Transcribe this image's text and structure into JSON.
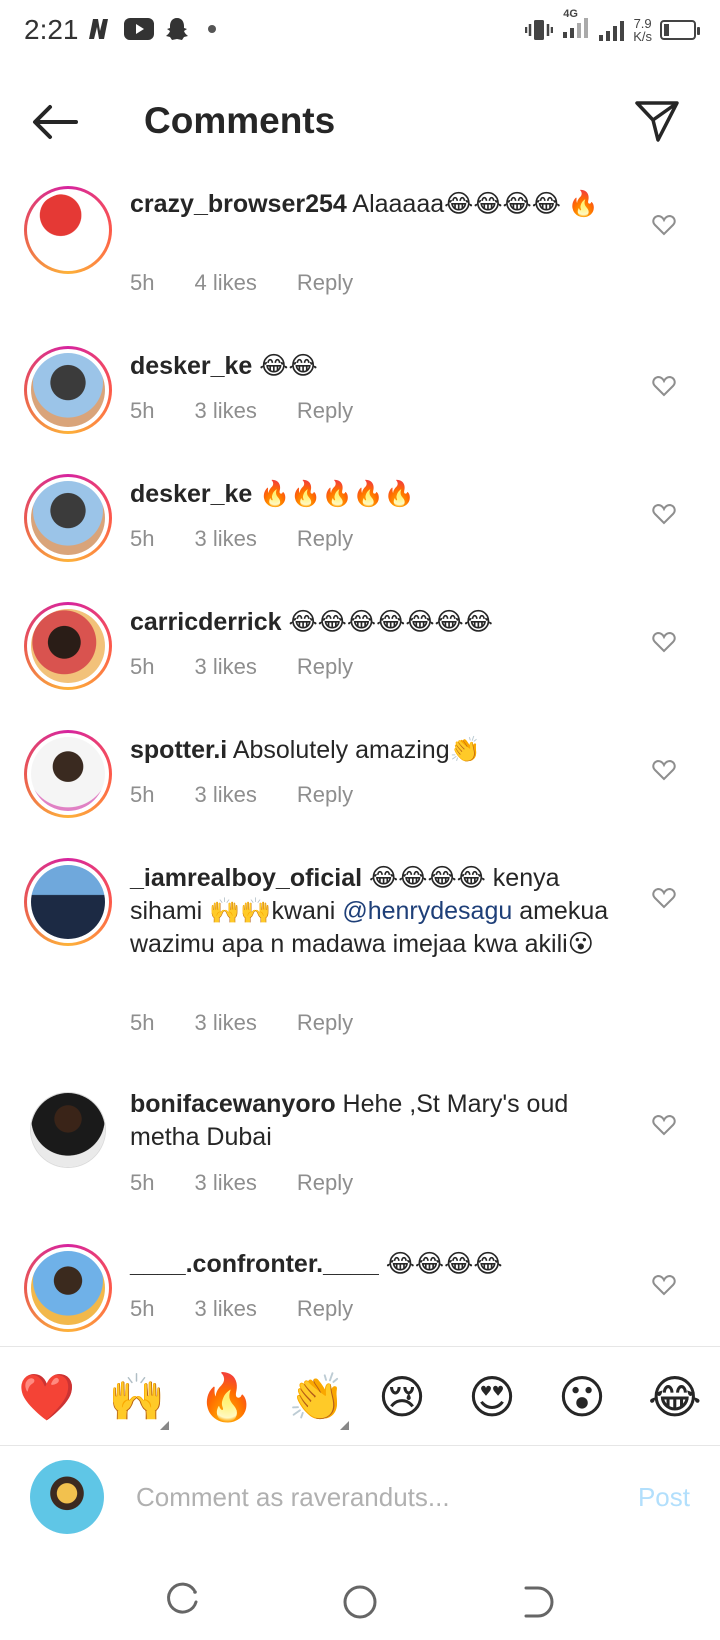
{
  "status_bar": {
    "time": "2:21",
    "network_type": "4G",
    "speed_value": "7.9",
    "speed_unit": "K/s"
  },
  "header": {
    "title": "Comments"
  },
  "comments": [
    {
      "username": "crazy_browser254",
      "text": "Alaaaaa😂😂😂😂 🔥",
      "time": "5h",
      "likes": "4 likes",
      "reply": "Reply"
    },
    {
      "username": "desker_ke",
      "text": "😂😂",
      "time": "5h",
      "likes": "3 likes",
      "reply": "Reply"
    },
    {
      "username": "desker_ke",
      "text": "🔥🔥🔥🔥🔥",
      "time": "5h",
      "likes": "3 likes",
      "reply": "Reply"
    },
    {
      "username": "carricderrick",
      "text": "😂😂😂😂😂😂😂",
      "time": "5h",
      "likes": "3 likes",
      "reply": "Reply"
    },
    {
      "username": "spotter.i",
      "text": "Absolutely amazing👏",
      "time": "5h",
      "likes": "3 likes",
      "reply": "Reply"
    },
    {
      "username": "_iamrealboy_oficial",
      "text_before": "😂😂😂😂 kenya sihami 🙌🙌kwani ",
      "mention": "@henrydesagu",
      "text_after": " amekua wazimu apa n madawa imejaa kwa akili😮",
      "time": "5h",
      "likes": "3 likes",
      "reply": "Reply"
    },
    {
      "username": "bonifacewanyoro",
      "text": "Hehe ,St Mary's oud metha Dubai",
      "time": "5h",
      "likes": "3 likes",
      "reply": "Reply"
    },
    {
      "username": "____.confronter.____",
      "text": "😂😂😂😂",
      "time": "5h",
      "likes": "3 likes",
      "reply": "Reply"
    }
  ],
  "emoji_bar": [
    "❤️",
    "🙌",
    "🔥",
    "👏",
    "😢",
    "😍",
    "😮",
    "😂"
  ],
  "composer": {
    "placeholder": "Comment as raveranduts...",
    "post_label": "Post"
  },
  "colors": {
    "post_disabled": "#b2dffc",
    "meta_gray": "#8e8e8e",
    "mention_blue": "#1e3f78"
  }
}
